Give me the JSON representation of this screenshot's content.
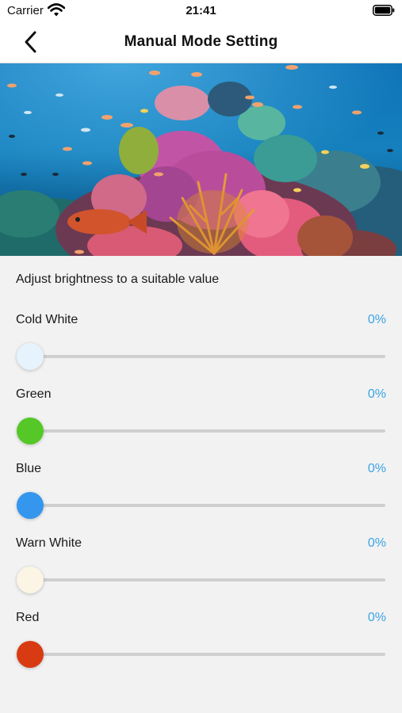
{
  "status_bar": {
    "carrier": "Carrier",
    "time": "21:41"
  },
  "nav": {
    "title": "Manual Mode Setting"
  },
  "instruction": "Adjust brightness to a suitable value",
  "sliders": [
    {
      "label": "Cold White",
      "value_text": "0%",
      "value": 0,
      "thumb_color": "#e6f2fc"
    },
    {
      "label": "Green",
      "value_text": "0%",
      "value": 0,
      "thumb_color": "#55c827"
    },
    {
      "label": "Blue",
      "value_text": "0%",
      "value": 0,
      "thumb_color": "#3596ee"
    },
    {
      "label": "Warn White",
      "value_text": "0%",
      "value": 0,
      "thumb_color": "#fcf4e5"
    },
    {
      "label": "Red",
      "value_text": "0%",
      "value": 0,
      "thumb_color": "#d83a12"
    }
  ],
  "colors": {
    "accent": "#3aa4e3",
    "track": "#cfcfcf",
    "background": "#f2f2f2"
  }
}
